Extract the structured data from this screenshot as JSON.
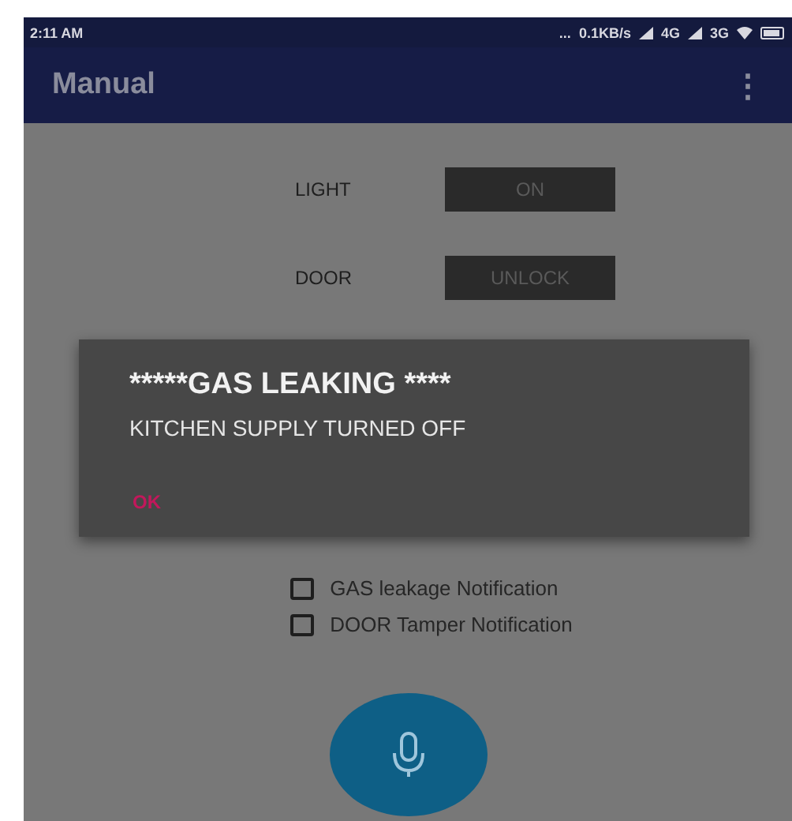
{
  "status_bar": {
    "time": "2:11 AM",
    "dots": "...",
    "speed": "0.1KB/s",
    "network_1": "4G",
    "network_2": "3G"
  },
  "app_bar": {
    "title": "Manual",
    "menu": "⋮"
  },
  "controls": [
    {
      "label": "LIGHT",
      "button": "ON"
    },
    {
      "label": "DOOR",
      "button": "UNLOCK"
    }
  ],
  "dialog": {
    "title": "*****GAS LEAKING ****",
    "message": "KITCHEN SUPPLY TURNED OFF",
    "button": "OK"
  },
  "notifications": [
    {
      "label": "GAS leakage Notification",
      "checked": false
    },
    {
      "label": "DOOR Tamper Notification",
      "checked": false
    }
  ],
  "mic_button": {
    "kind": "fab"
  }
}
